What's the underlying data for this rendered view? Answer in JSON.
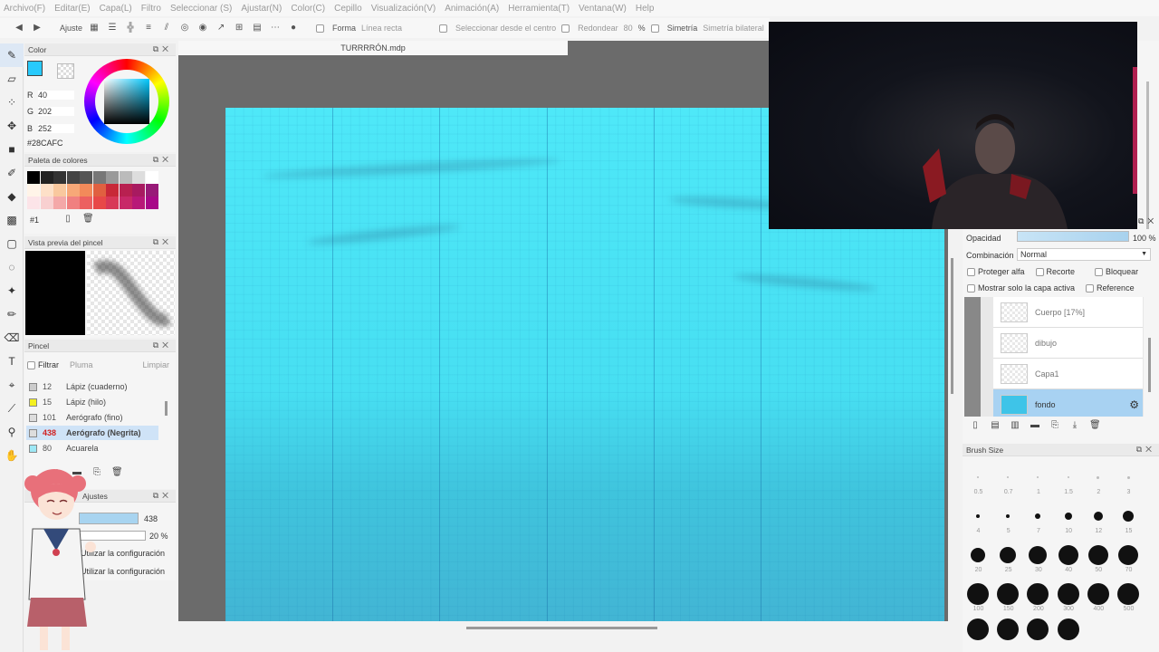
{
  "menu": [
    "Archivo(F)",
    "Editar(E)",
    "Capa(L)",
    "Filtro",
    "Seleccionar (S)",
    "Ajustar(N)",
    "Color(C)",
    "Cepillo",
    "Visualización(V)",
    "Animación(A)",
    "Herramienta(T)",
    "Ventana(W)",
    "Help"
  ],
  "toolbar": {
    "ajuste": "Ajuste",
    "forma": "Forma",
    "forma_value": "Línea recta",
    "seleccionar_centro": "Seleccionar desde el centro",
    "redondear": "Redondear",
    "redondear_value": "80",
    "percent": "%",
    "simetria": "Simetría",
    "simetria_value": "Simetría bilateral"
  },
  "document": {
    "tab": "TURRRRÓN.mdp"
  },
  "color": {
    "title": "Color",
    "r_label": "R",
    "r": "40",
    "g_label": "G",
    "g": "202",
    "b_label": "B",
    "b": "252",
    "hex": "#28CAFC",
    "current": "#28CAFC"
  },
  "palette": {
    "title": "Paleta de colores",
    "set": "#1",
    "swatches": [
      "#000000",
      "#222222",
      "#333333",
      "#444444",
      "#555555",
      "#777777",
      "#999999",
      "#bbbbbb",
      "#dddddd",
      "#ffffff",
      "#fff4e8",
      "#fde0c8",
      "#f9c89e",
      "#f7a878",
      "#f28a5a",
      "#e06040",
      "#c82838",
      "#b82050",
      "#a81a60",
      "#981a78",
      "#fce4e8",
      "#f8d0d0",
      "#f4a8a8",
      "#f08080",
      "#ec6060",
      "#e84848",
      "#d83858",
      "#c82868",
      "#b81878",
      "#a80888"
    ]
  },
  "preview": {
    "title": "Vista previa del pincel"
  },
  "brushes": {
    "title": "Pincel",
    "filter": "Filtrar",
    "filter_value": "Pluma",
    "clear": "Limpiar",
    "items": [
      {
        "num": "12",
        "name": "Lápiz (cuaderno)",
        "color": "#cccccc"
      },
      {
        "num": "15",
        "name": "Lápiz (hilo)",
        "color": "#f4f020"
      },
      {
        "num": "101",
        "name": "Aerógrafo (fino)",
        "color": "#dddddd"
      },
      {
        "num": "438",
        "name": "Aerógrafo (Negrita)",
        "color": "#dddddd"
      },
      {
        "num": "80",
        "name": "Acuarela",
        "color": "#9ee8f5"
      }
    ]
  },
  "settings": {
    "title": "Ajustes",
    "size": "438",
    "opacity": "20 %",
    "opt1": "Utilizar la configuración",
    "opt2": "Utilizar la configuración"
  },
  "layers": {
    "opacity_label": "Opacidad",
    "opacity": "100 %",
    "blend_label": "Combinación",
    "blend": "Normal",
    "alpha": "Proteger alfa",
    "clip": "Recorte",
    "lock": "Bloquear",
    "only_active": "Mostrar solo la capa activa",
    "reference": "Reference",
    "items": [
      {
        "name": "Cuerpo [17%]"
      },
      {
        "name": "dibujo"
      },
      {
        "name": "Capa1"
      },
      {
        "name": "fondo"
      }
    ]
  },
  "brushsize": {
    "title": "Brush Size",
    "labels": [
      "0.5",
      "0.7",
      "1",
      "1.5",
      "2",
      "3",
      "4",
      "5",
      "7",
      "10",
      "12",
      "15",
      "20",
      "25",
      "30",
      "40",
      "50",
      "70",
      "100",
      "150",
      "200",
      "300",
      "400",
      "500"
    ]
  }
}
